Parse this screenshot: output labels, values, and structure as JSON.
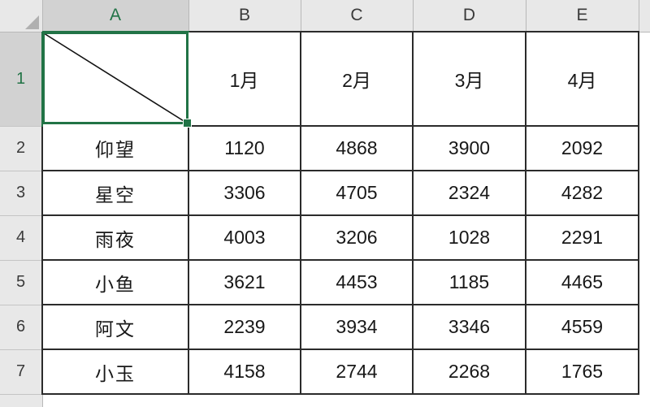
{
  "app": {
    "type": "spreadsheet",
    "accent_color": "#217346",
    "header_bg": "#e8e8e8",
    "header_selected_bg": "#d2d2d2",
    "cell_border_color": "#2b2b2b",
    "cell_bg": "#ffffff"
  },
  "corner": {
    "icon": "select-all-triangle-icon"
  },
  "columns": [
    {
      "label": "A",
      "selected": true
    },
    {
      "label": "B",
      "selected": false
    },
    {
      "label": "C",
      "selected": false
    },
    {
      "label": "D",
      "selected": false
    },
    {
      "label": "E",
      "selected": false
    }
  ],
  "rows": [
    {
      "label": "1",
      "selected": true
    },
    {
      "label": "2",
      "selected": false
    },
    {
      "label": "3",
      "selected": false
    },
    {
      "label": "4",
      "selected": false
    },
    {
      "label": "5",
      "selected": false
    },
    {
      "label": "6",
      "selected": false
    },
    {
      "label": "7",
      "selected": false
    }
  ],
  "selection": {
    "active_cell": "A1",
    "value": "",
    "has_diagonal_border": true,
    "has_fill_handle": true
  },
  "table": {
    "corner_cell": "",
    "column_headers": [
      "",
      "1月",
      "2月",
      "3月",
      "4月"
    ],
    "data_rows": [
      {
        "name": "仰望",
        "values": [
          "1120",
          "4868",
          "3900",
          "2092"
        ]
      },
      {
        "name": "星空",
        "values": [
          "3306",
          "4705",
          "2324",
          "4282"
        ]
      },
      {
        "name": "雨夜",
        "values": [
          "4003",
          "3206",
          "1028",
          "2291"
        ]
      },
      {
        "name": "小鱼",
        "values": [
          "3621",
          "4453",
          "1185",
          "4465"
        ]
      },
      {
        "name": "阿文",
        "values": [
          "2239",
          "3934",
          "3346",
          "4559"
        ]
      },
      {
        "name": "小玉",
        "values": [
          "4158",
          "2744",
          "2268",
          "1765"
        ]
      }
    ]
  }
}
